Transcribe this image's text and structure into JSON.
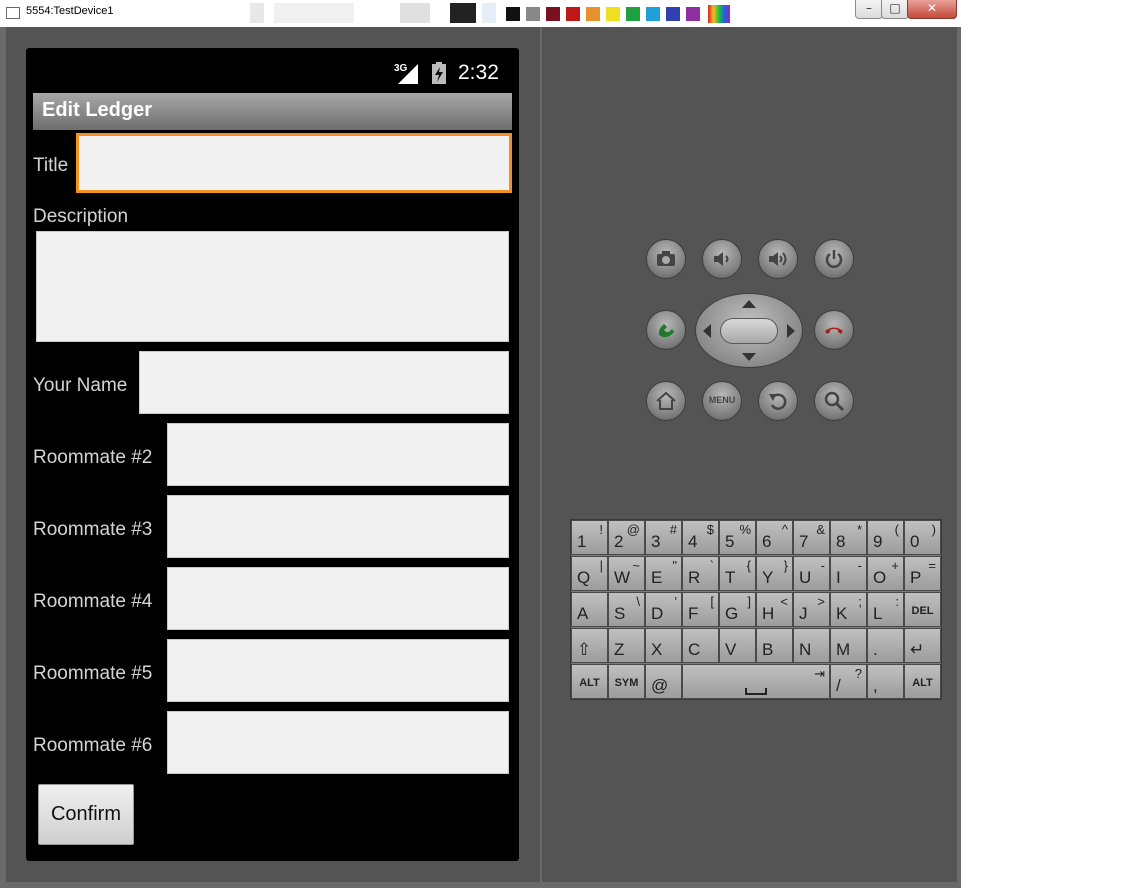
{
  "window": {
    "title": "5554:TestDevice1",
    "controls": {
      "minimize": "–",
      "maximize": "□",
      "close": "✕"
    }
  },
  "statusbar": {
    "network": "3G",
    "time": "2:32"
  },
  "app": {
    "title": "Edit Ledger",
    "fields": {
      "title_label": "Title",
      "description_label": "Description",
      "your_name_label": "Your Name",
      "roommate2_label": "Roommate #2",
      "roommate3_label": "Roommate #3",
      "roommate4_label": "Roommate #4",
      "roommate5_label": "Roommate #5",
      "roommate6_label": "Roommate #6"
    },
    "confirm_label": "Confirm"
  },
  "hardware_buttons": {
    "camera": "camera-icon",
    "volume_down": "volume-down-icon",
    "volume_up": "volume-up-icon",
    "power": "power-icon",
    "call": "call-icon",
    "end_call": "end-call-icon",
    "home": "home-icon",
    "menu_label": "MENU",
    "back": "back-icon",
    "search": "search-icon"
  },
  "keyboard": {
    "rows": [
      [
        {
          "m": "1",
          "a": "!"
        },
        {
          "m": "2",
          "a": "@"
        },
        {
          "m": "3",
          "a": "#"
        },
        {
          "m": "4",
          "a": "$"
        },
        {
          "m": "5",
          "a": "%"
        },
        {
          "m": "6",
          "a": "^"
        },
        {
          "m": "7",
          "a": "&"
        },
        {
          "m": "8",
          "a": "*"
        },
        {
          "m": "9",
          "a": "("
        },
        {
          "m": "0",
          "a": ")"
        }
      ],
      [
        {
          "m": "Q",
          "a": "|"
        },
        {
          "m": "W",
          "a": "~"
        },
        {
          "m": "E",
          "a": "\""
        },
        {
          "m": "R",
          "a": "`"
        },
        {
          "m": "T",
          "a": "{"
        },
        {
          "m": "Y",
          "a": "}"
        },
        {
          "m": "U",
          "a": "-"
        },
        {
          "m": "I",
          "a": "-"
        },
        {
          "m": "O",
          "a": "+"
        },
        {
          "m": "P",
          "a": "="
        }
      ],
      [
        {
          "m": "A",
          "a": ""
        },
        {
          "m": "S",
          "a": "\\"
        },
        {
          "m": "D",
          "a": "'"
        },
        {
          "m": "F",
          "a": "["
        },
        {
          "m": "G",
          "a": "]"
        },
        {
          "m": "H",
          "a": "<"
        },
        {
          "m": "J",
          "a": ">"
        },
        {
          "m": "K",
          "a": ";"
        },
        {
          "m": "L",
          "a": ":"
        },
        {
          "m": "DEL",
          "a": ""
        }
      ],
      [
        {
          "m": "⇧",
          "a": ""
        },
        {
          "m": "Z",
          "a": ""
        },
        {
          "m": "X",
          "a": ""
        },
        {
          "m": "C",
          "a": ""
        },
        {
          "m": "V",
          "a": ""
        },
        {
          "m": "B",
          "a": ""
        },
        {
          "m": "N",
          "a": ""
        },
        {
          "m": "M",
          "a": ""
        },
        {
          "m": ".",
          "a": ""
        },
        {
          "m": "↵",
          "a": ""
        }
      ]
    ],
    "bottom": {
      "alt_left": "ALT",
      "sym": "SYM",
      "at": "@",
      "space_tab": "⇥",
      "slash": "/",
      "question": "?",
      "comma": ",",
      "alt_right": "ALT"
    }
  },
  "colors": {
    "focus_border": "#f29022",
    "call_green": "#1e7a2a",
    "end_red": "#b01a1a"
  }
}
